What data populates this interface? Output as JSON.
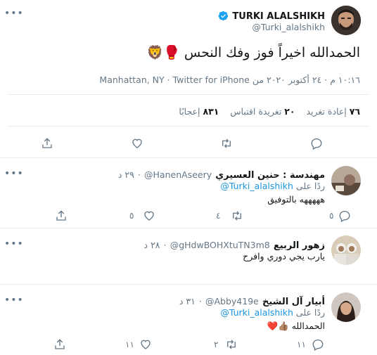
{
  "main_tweet": {
    "author_name": "TURKI ALALSHIKH",
    "author_handle": "@Turki_alalshikh",
    "text": "الحمدالله اخيراً فوز وفك النحس",
    "emoji": "🥊🦁",
    "timestamp": "١٠:١٦ م · ٢٤ أكتوبر ٢٠٢٠ من",
    "source": "Manhattan, NY · Twitter for iPhone",
    "stats": {
      "retweets_count": "٧٦",
      "retweets_label": "إعادة تغريد",
      "quotes_count": "٢٠",
      "quotes_label": "تغريدة اقتباس",
      "likes_count": "٨٣١",
      "likes_label": "إعجابًا"
    }
  },
  "replies": [
    {
      "author_name": "مهندسة : حنين العسيري",
      "author_handle": "@HanenAseery",
      "time": "٢٩ د",
      "replying_prefix": "ردًا على",
      "replying_to": "@Turki_alalshikh",
      "text": "هههههه بالتوفيق",
      "reply_count": "٥",
      "retweet_count": "٤",
      "like_count": "٥"
    },
    {
      "author_name": "زهور الربيع",
      "author_handle": "@gHdwBOHXtuTN3m8",
      "time": "٢٨ د",
      "text": "يارب يجي دوري وافرح",
      "reply_count": "",
      "retweet_count": "",
      "like_count": ""
    },
    {
      "author_name": "أبيار آل الشيخ",
      "author_handle": "@Abby419e",
      "time": "٣١ د",
      "replying_prefix": "ردًا على",
      "replying_to": "@Turki_alalshikh",
      "text": "الحمدالله",
      "emoji": "👍🏽❤️",
      "reply_count": "١١",
      "retweet_count": "٢",
      "like_count": "١١"
    }
  ],
  "colors": {
    "accent": "#1da1f2",
    "link": "#1b95e0",
    "secondary_text": "#657786",
    "border": "#e6ecf0"
  },
  "icons": {
    "more": "more-dots-icon",
    "verified": "verified-badge-icon",
    "reply": "reply-bubble-icon",
    "retweet": "retweet-icon",
    "like": "heart-icon",
    "share": "share-upload-icon"
  }
}
